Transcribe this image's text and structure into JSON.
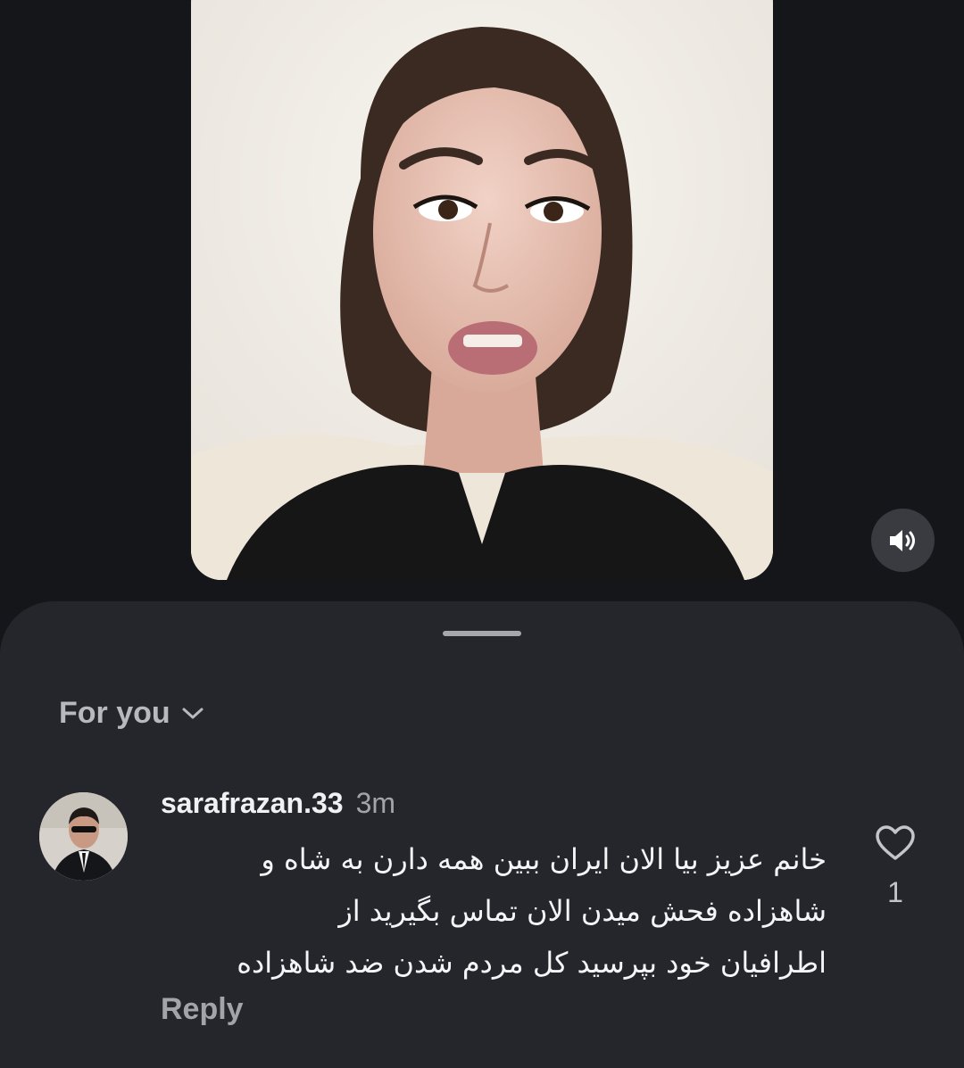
{
  "video": {
    "mute_icon": "speaker-volume-icon"
  },
  "comments_sheet": {
    "sort": {
      "label": "For you",
      "icon": "chevron-down-icon"
    },
    "comment": {
      "username": "sarafrazan.33",
      "time": "3m",
      "text_lines": [
        "خانم عزیز بیا الان ایران ببین همه دارن به شاه و",
        "شاهزاده فحش میدن الان تماس بگیرید از",
        "اطرافیان خود بپرسید کل مردم شدن ضد شاهزاده"
      ],
      "like_icon": "heart-outline-icon",
      "like_count": "1",
      "reply_label": "Reply"
    }
  },
  "colors": {
    "background": "#15161a",
    "sheet": "#25262c",
    "primary_text": "#f1f1f3",
    "secondary_text": "#a3a4aa"
  }
}
